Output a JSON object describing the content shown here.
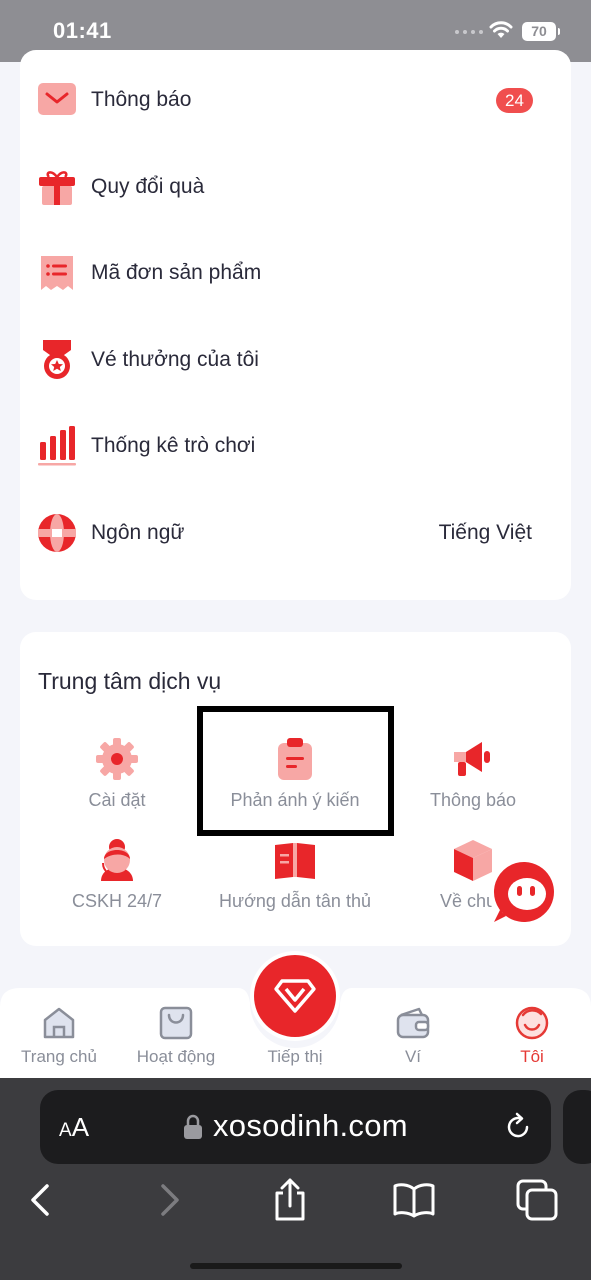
{
  "status_bar": {
    "time": "01:41",
    "battery": "70"
  },
  "menu": [
    {
      "label": "Thông báo",
      "badge": "24",
      "icon": "mail-icon"
    },
    {
      "label": "Quy đổi quà",
      "icon": "gift-icon"
    },
    {
      "label": "Mã đơn sản phẩm",
      "icon": "receipt-icon"
    },
    {
      "label": "Vé thưởng của tôi",
      "icon": "medal-icon"
    },
    {
      "label": "Thống kê trò chơi",
      "icon": "bar-chart-icon"
    },
    {
      "label": "Ngôn ngữ",
      "value": "Tiếng Việt",
      "icon": "globe-icon"
    }
  ],
  "service_center": {
    "title": "Trung tâm dịch vụ",
    "items": [
      {
        "label": "Cài đặt",
        "icon": "gear-icon"
      },
      {
        "label": "Phản ánh ý kiến",
        "icon": "feedback-clipboard-icon"
      },
      {
        "label": "Thông báo",
        "icon": "megaphone-icon"
      },
      {
        "label": "CSKH 24/7",
        "icon": "support-agent-icon"
      },
      {
        "label": "Hướng dẫn tân thủ",
        "icon": "guide-book-icon"
      },
      {
        "label": "Về chún",
        "icon": "box-icon"
      }
    ]
  },
  "tabbar": [
    {
      "label": "Trang chủ",
      "icon": "home-icon"
    },
    {
      "label": "Hoạt động",
      "icon": "activity-bag-icon"
    },
    {
      "label": "Tiếp thị",
      "icon": "diamond-icon"
    },
    {
      "label": "Ví",
      "icon": "wallet-icon"
    },
    {
      "label": "Tôi",
      "icon": "profile-smile-icon",
      "active": true
    }
  ],
  "browser": {
    "aa_label_small": "A",
    "aa_label_large": "A",
    "url": "xosodinh.com"
  },
  "colors": {
    "accent": "#e8262a",
    "icon_light": "#f7a7a5",
    "badge": "#f04e4e",
    "muted_text": "#8a8e99"
  }
}
